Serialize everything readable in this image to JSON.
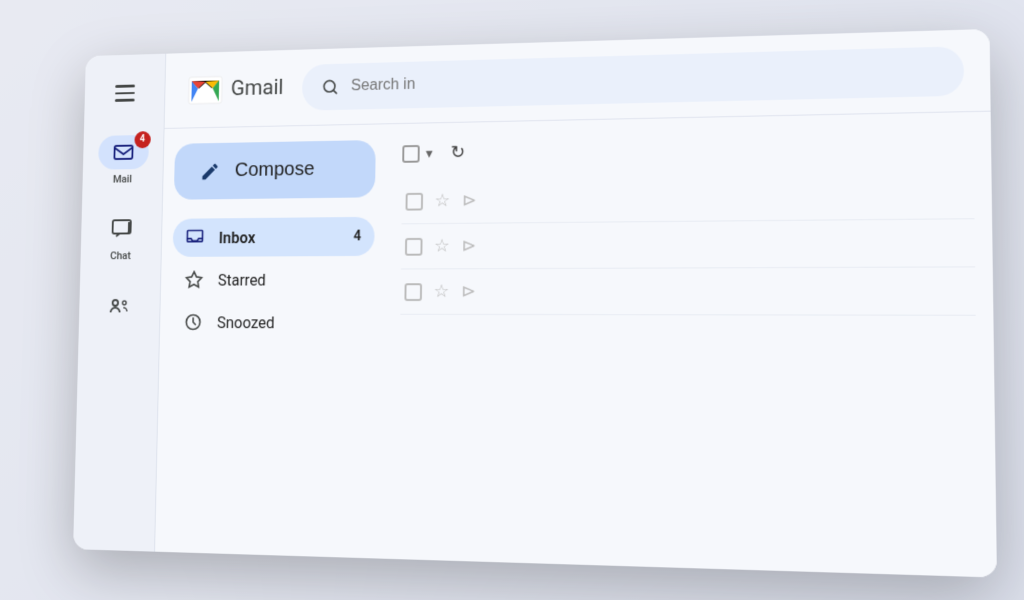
{
  "app": {
    "title": "Gmail",
    "search_placeholder": "Search in"
  },
  "sidebar": {
    "hamburger_label": "Menu",
    "items": [
      {
        "id": "mail",
        "label": "Mail",
        "active": true,
        "badge": "4"
      },
      {
        "id": "chat",
        "label": "Chat",
        "active": false,
        "badge": null
      },
      {
        "id": "meet",
        "label": "",
        "active": false,
        "badge": null
      }
    ]
  },
  "nav": {
    "compose_label": "Compose",
    "items": [
      {
        "id": "inbox",
        "label": "Inbox",
        "active": true,
        "count": "4"
      },
      {
        "id": "starred",
        "label": "Starred",
        "active": false,
        "count": null
      },
      {
        "id": "snoozed",
        "label": "Snoozed",
        "active": false,
        "count": null
      }
    ]
  },
  "toolbar": {
    "select_all_label": "Select all",
    "refresh_label": "Refresh"
  },
  "email_rows": [
    {
      "id": "row-1"
    },
    {
      "id": "row-2"
    },
    {
      "id": "row-3"
    }
  ]
}
